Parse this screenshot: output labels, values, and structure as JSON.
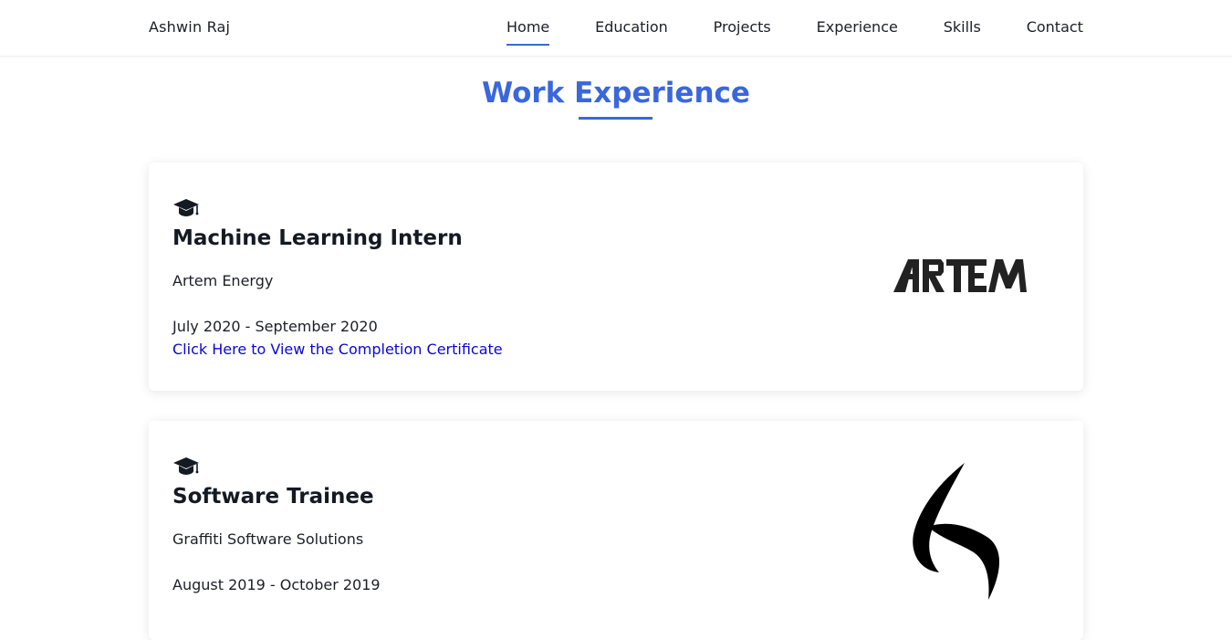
{
  "nav": {
    "brand": "Ashwin Raj",
    "links": [
      "Home",
      "Education",
      "Projects",
      "Experience",
      "Skills",
      "Contact"
    ],
    "active": "Home"
  },
  "section": {
    "title": "Work Experience"
  },
  "experiences": [
    {
      "icon": "graduation-cap-icon",
      "title": "Machine Learning Intern",
      "company": "Artem Energy",
      "dates": "July 2020 - September 2020",
      "link_text": "Click Here to View the Completion Certificate",
      "logo_text": "ARTEM"
    },
    {
      "icon": "graduation-cap-icon",
      "title": "Software Trainee",
      "company": "Graffiti Software Solutions",
      "dates": "August 2019 - October 2019"
    }
  ],
  "colors": {
    "accent": "#3b67dc",
    "link": "#0b06d6",
    "text": "#1c1f26"
  }
}
